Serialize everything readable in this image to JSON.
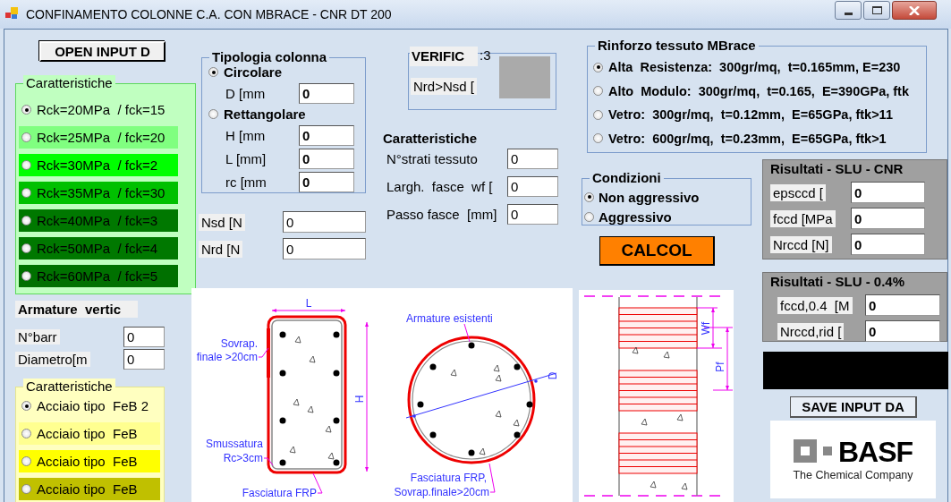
{
  "window": {
    "title": "CONFINAMENTO COLONNE C.A. CON MBRACE - CNR DT 200"
  },
  "open_button": "OPEN INPUT D",
  "concrete": {
    "title": "Caratteristiche",
    "options": [
      {
        "label": "Rck=20MPa  / fck=15",
        "selected": true,
        "color": "#c0ffc0"
      },
      {
        "label": "Rck=25MPa  / fck=20",
        "selected": false,
        "color": "#80ff80"
      },
      {
        "label": "Rck=30MPa  / fck=2",
        "selected": false,
        "color": "#00ff00"
      },
      {
        "label": "Rck=35MPa  / fck=30",
        "selected": false,
        "color": "#00c000"
      },
      {
        "label": "Rck=40MPa  / fck=3",
        "selected": false,
        "color": "#007800"
      },
      {
        "label": "Rck=50MPa  / fck=4",
        "selected": false,
        "color": "#007800"
      },
      {
        "label": "Rck=60MPa  / fck=5",
        "selected": false,
        "color": "#007000"
      }
    ]
  },
  "column_type": {
    "title": "Tipologia colonna",
    "options": [
      {
        "label": "Circolare",
        "selected": true,
        "fields": [
          {
            "label": "D [mm",
            "value": "0"
          }
        ]
      },
      {
        "label": "Rettangolare",
        "selected": false,
        "fields": [
          {
            "label": "H [mm",
            "value": "0"
          },
          {
            "label": "L [mm]",
            "value": "0"
          },
          {
            "label": "rc [mm",
            "value": "0"
          }
        ]
      }
    ]
  },
  "loads": [
    {
      "label": "Nsd [N",
      "value": "0"
    },
    {
      "label": "Nrd [N",
      "value": "0"
    }
  ],
  "verification": {
    "title": "VERIFIC",
    "legend_tail": ":3",
    "label": "Nrd>Nsd ["
  },
  "frp": {
    "title": "Caratteristiche",
    "fields": [
      {
        "label": "N°strati tessuto",
        "value": "0"
      },
      {
        "label": "Largh.  fasce  wf [",
        "value": "0"
      },
      {
        "label": "Passo fasce  [mm]",
        "value": "0"
      }
    ]
  },
  "fabric": {
    "title": "Rinforzo tessuto MBrace",
    "options": [
      {
        "label": "Alta  Resistenza:  300gr/mq,  t=0.165mm, E=230",
        "selected": true
      },
      {
        "label": "Alto  Modulo:  300gr/mq,  t=0.165,  E=390GPa, ftk",
        "selected": false
      },
      {
        "label": "Vetro:  300gr/mq,  t=0.12mm,  E=65GPa, ftk>11",
        "selected": false
      },
      {
        "label": "Vetro:  600gr/mq,  t=0.23mm,  E=65GPa, ftk>1",
        "selected": false
      }
    ]
  },
  "environment": {
    "title": "Condizioni",
    "options": [
      {
        "label": "Non aggressivo",
        "selected": true
      },
      {
        "label": "Aggressivo",
        "selected": false
      }
    ]
  },
  "calc_button": "CALCOL",
  "results_cnr": {
    "title": "Risultati - SLU - CNR",
    "fields": [
      {
        "label": "epsccd [",
        "value": "0"
      },
      {
        "label": "fccd [MPa",
        "value": "0"
      },
      {
        "label": "Nrccd [N]",
        "value": "0"
      }
    ]
  },
  "results_04": {
    "title": "Risultati - SLU - 0.4%",
    "fields": [
      {
        "label": "fccd,0.4  [M",
        "value": "0"
      },
      {
        "label": "Nrccd,rid [",
        "value": "0"
      }
    ]
  },
  "save_button": "SAVE INPUT DA",
  "logo": {
    "name": "BASF",
    "tagline": "The Chemical Company"
  },
  "rebars": {
    "title": "Armature  vertic",
    "fields": [
      {
        "label": "N°barr",
        "value": "0"
      },
      {
        "label": "Diametro[m",
        "value": "0"
      }
    ]
  },
  "steel": {
    "title": "Caratteristiche",
    "options": [
      {
        "label": "Acciaio tipo  FeB 2",
        "selected": true,
        "color": "#ffffc0"
      },
      {
        "label": "Acciaio tipo  FeB",
        "selected": false,
        "color": "#ffff90"
      },
      {
        "label": "Acciaio tipo  FeB",
        "selected": false,
        "color": "#ffff00"
      },
      {
        "label": "Acciaio tipo  FeB",
        "selected": false,
        "color": "#c0c000"
      }
    ]
  },
  "section_diagram": {
    "labels": [
      "L",
      "H",
      "Sovrap.",
      "finale >20cm",
      "Smussatura",
      "Rc>3cm",
      "Fasciatura FRP",
      "Armature esistenti",
      "D",
      "Fasciatura FRP,",
      "Sovrap.finale>20cm"
    ]
  },
  "band_diagram": {
    "labels": [
      "Wf",
      "Pf"
    ]
  }
}
